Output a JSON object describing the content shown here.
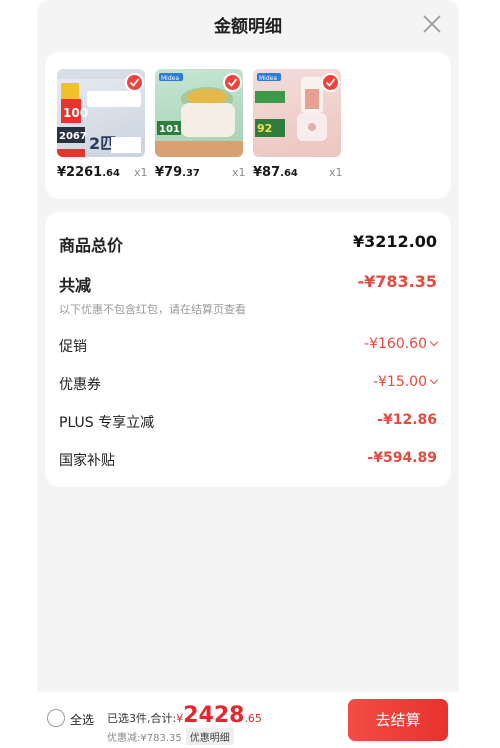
{
  "header": {
    "title": "金额明细",
    "close_icon": "close-icon"
  },
  "products": [
    {
      "name": "air-conditioner",
      "price_int": "¥2261",
      "price_dec": ".64",
      "qty": "x1",
      "image_text": "100",
      "image_text2": "2067",
      "image_text3": "2匹"
    },
    {
      "name": "rice-cooker",
      "price_int": "¥79",
      "price_dec": ".37",
      "qty": "x1",
      "image_text": "101",
      "brand": "Midea"
    },
    {
      "name": "blender",
      "price_int": "¥87",
      "price_dec": ".64",
      "qty": "x1",
      "image_text": "92",
      "brand": "Midea"
    }
  ],
  "details": {
    "total_label": "商品总价",
    "total_value": "¥3212.00",
    "reduce_label": "共减",
    "reduce_value": "-¥783.35",
    "note": "以下优惠不包含红包，请在结算页查看",
    "promo_label": "促销",
    "promo_value": "-¥160.60",
    "coupon_label": "优惠券",
    "coupon_value": "-¥15.00",
    "plus_label": "PLUS 专享立减",
    "plus_value": "-¥12.86",
    "subsidy_label": "国家补贴",
    "subsidy_value": "-¥594.89"
  },
  "footer": {
    "select_all": "全选",
    "summary_prefix": "已选3件,合计:",
    "currency": "¥",
    "total_int": "2428",
    "total_dec": ".65",
    "discount": "优惠减:¥783.35",
    "detail_badge": "优惠明细",
    "checkout": "去结算"
  },
  "colors": {
    "accent": "#e44a3d",
    "button": "#ef3f38",
    "sheet_bg": "#f4f4f4"
  }
}
